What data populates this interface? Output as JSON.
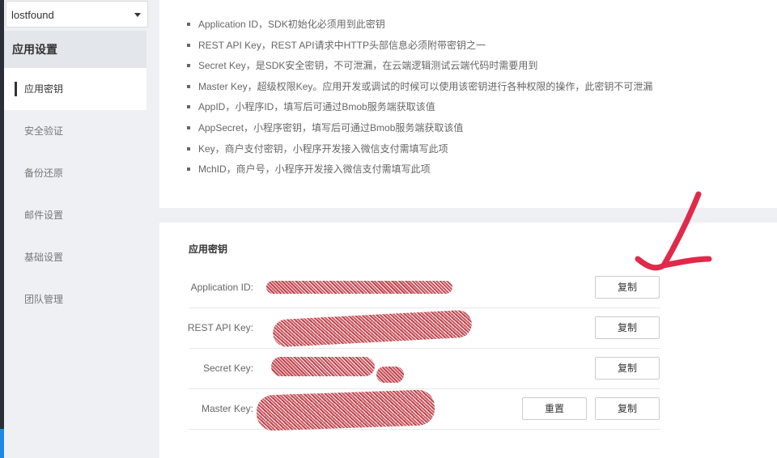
{
  "sidebar": {
    "app_select_value": "lostfound",
    "section_title": "应用设置",
    "items": [
      {
        "label": "应用密钥",
        "active": true
      },
      {
        "label": "安全验证"
      },
      {
        "label": "备份还原"
      },
      {
        "label": "邮件设置"
      },
      {
        "label": "基础设置"
      },
      {
        "label": "团队管理"
      }
    ]
  },
  "notes": [
    "Application ID，SDK初始化必须用到此密钥",
    "REST API Key，REST API请求中HTTP头部信息必须附带密钥之一",
    "Secret Key，是SDK安全密钥，不可泄漏，在云端逻辑测试云端代码时需要用到",
    "Master Key，超级权限Key。应用开发或调试的时候可以使用该密钥进行各种权限的操作，此密钥不可泄漏",
    "AppID，小程序ID，填写后可通过Bmob服务端获取该值",
    "AppSecret，小程序密钥，填写后可通过Bmob服务端获取该值",
    "Key，商户支付密钥，小程序开发接入微信支付需填写此项",
    "MchID，商户号，小程序开发接入微信支付需填写此项"
  ],
  "keys": {
    "title": "应用密钥",
    "rows": [
      {
        "label": "Application ID:",
        "copy": "复制"
      },
      {
        "label": "REST API Key:",
        "copy": "复制"
      },
      {
        "label": "Secret Key:",
        "copy": "复制"
      },
      {
        "label": "Master Key:",
        "copy": "复制",
        "reset": "重置"
      }
    ]
  },
  "colors": {
    "annotation": "#e02a4a",
    "redaction": "#b4323c"
  }
}
